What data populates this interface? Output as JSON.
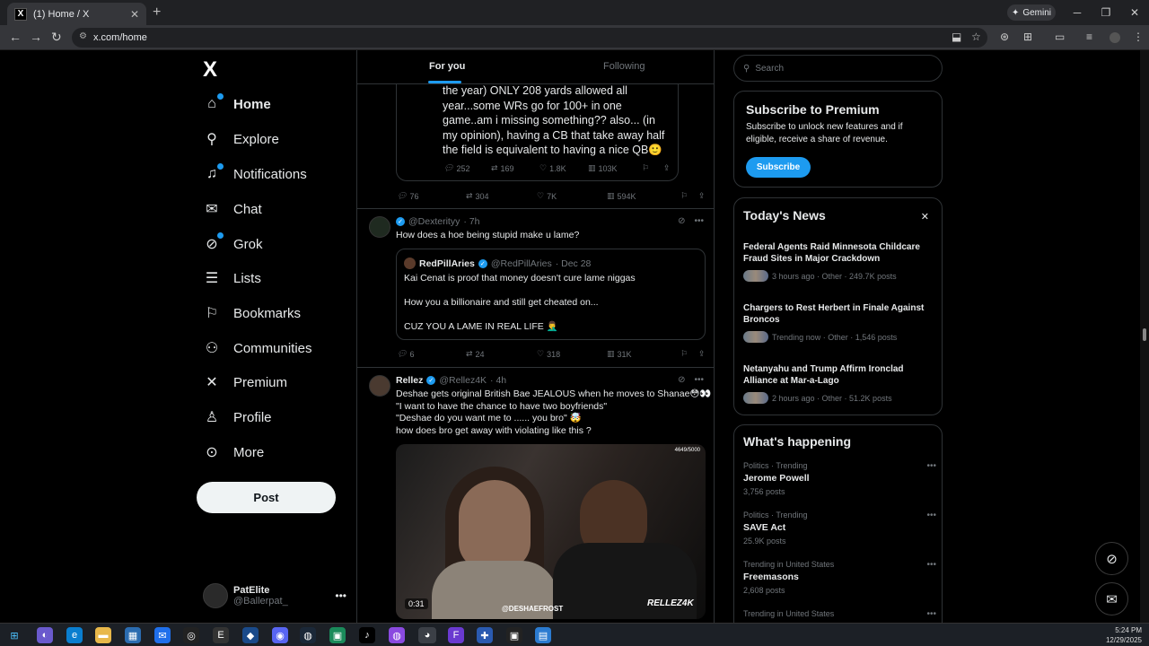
{
  "browser": {
    "tab_title": "(1) Home / X",
    "tab_icon": "X",
    "new_tab": "+",
    "url": "x.com/home",
    "gemini_label": "Gemini"
  },
  "left_nav": {
    "logo": "X",
    "items": [
      {
        "label": "Home",
        "icon": "home-icon",
        "active": true
      },
      {
        "label": "Explore",
        "icon": "search-icon"
      },
      {
        "label": "Notifications",
        "icon": "bell-icon",
        "badge": "1"
      },
      {
        "label": "Chat",
        "icon": "mail-icon"
      },
      {
        "label": "Grok",
        "icon": "grok-icon"
      },
      {
        "label": "Lists",
        "icon": "list-icon"
      },
      {
        "label": "Bookmarks",
        "icon": "bookmark-icon"
      },
      {
        "label": "Communities",
        "icon": "communities-icon"
      },
      {
        "label": "Premium",
        "icon": "x-premium-icon"
      },
      {
        "label": "Profile",
        "icon": "person-icon"
      },
      {
        "label": "More",
        "icon": "more-icon"
      }
    ],
    "post_button": "Post",
    "account": {
      "name": "PatElite",
      "handle": "@Ballerpat_"
    }
  },
  "feed": {
    "tabs": [
      {
        "label": "For you"
      },
      {
        "label": "Following"
      }
    ],
    "partial_post": {
      "quote_text": "the year) ONLY 208 yards allowed all year...some WRs go for 100+ in one game..am i missing something?? also... (in my opinion), having a CB that take away half the field is equivalent to having a nice QB🙂",
      "quote_metrics": {
        "replies": "252",
        "reposts": "169",
        "likes": "1.8K",
        "views": "103K"
      },
      "metrics": {
        "replies": "76",
        "reposts": "304",
        "likes": "7K",
        "views": "594K"
      }
    },
    "post2": {
      "handle": "@Dexterityy",
      "time": "· 7h",
      "text": "How does a hoe being stupid make u lame?",
      "quote": {
        "name": "RedPillAries",
        "handle": "@RedPillAries",
        "time": "· Dec 28",
        "text": "Kai Cenat is proof that money doesn't cure lame niggas\n\nHow you a billionaire and still get cheated on...\n\nCUZ YOU A LAME IN REAL LIFE 🤦‍♂️"
      },
      "metrics": {
        "replies": "6",
        "reposts": "24",
        "likes": "318",
        "views": "31K"
      }
    },
    "post3": {
      "name": "Rellez",
      "handle": "@Rellez4K",
      "time": "· 4h",
      "text": "Deshae gets original British Bae JEALOUS when he moves to Shanae😳👀\n\"I want to have the chance to have two boyfriends\"\n\"Deshae do you want me to ...... you bro\" 🤯\nhow does bro get away with violating like this ?",
      "video": {
        "time": "0:31",
        "counter": "4649/5000",
        "watermark1": "@DESHAEFROST",
        "watermark2": "RELLEZ4K"
      }
    }
  },
  "right": {
    "search_placeholder": "Search",
    "premium": {
      "title": "Subscribe to Premium",
      "text": "Subscribe to unlock new features and if eligible, receive a share of revenue.",
      "button": "Subscribe"
    },
    "news": {
      "title": "Today's News",
      "items": [
        {
          "headline": "Federal Agents Raid Minnesota Childcare Fraud Sites in Major Crackdown",
          "meta": "3 hours ago · Other · 249.7K posts"
        },
        {
          "headline": "Chargers to Rest Herbert in Finale Against Broncos",
          "meta": "Trending now · Other · 1,546 posts"
        },
        {
          "headline": "Netanyahu and Trump Affirm Ironclad Alliance at Mar-a-Lago",
          "meta": "2 hours ago · Other · 51.2K posts"
        }
      ]
    },
    "happening": {
      "title": "What's happening",
      "trends": [
        {
          "category": "Politics · Trending",
          "name": "Jerome Powell",
          "count": "3,756 posts"
        },
        {
          "category": "Politics · Trending",
          "name": "SAVE Act",
          "count": "25.9K posts"
        },
        {
          "category": "Trending in United States",
          "name": "Freemasons",
          "count": "2,608 posts"
        },
        {
          "category": "Trending in United States",
          "name": "",
          "count": ""
        }
      ]
    }
  },
  "taskbar": {
    "time": "5:24 PM",
    "date": "12/29/2025"
  },
  "colors": {
    "accent": "#1d9bf0",
    "background": "#000000",
    "border": "#2f3336",
    "muted": "#71767b"
  }
}
